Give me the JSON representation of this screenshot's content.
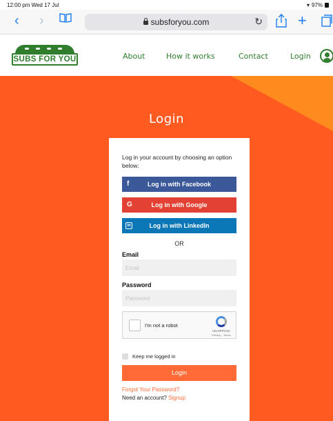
{
  "status_bar": {
    "time": "12:00 pm  Wed 17 Jul",
    "battery": "97%"
  },
  "browser": {
    "url": "subsforyou.com"
  },
  "site_nav": {
    "logo_text": "SUBS FOR YOU",
    "links": {
      "about": "About",
      "how_it_works": "How it works",
      "contact": "Contact",
      "login": "Login"
    }
  },
  "page": {
    "title": "Login"
  },
  "login_card": {
    "intro": "Log in your account by choosing an option below:",
    "facebook_label": "Log in with Facebook",
    "google_label": "Log in with Google",
    "linkedin_label": "Log in with LinkedIn",
    "facebook_icon": "f",
    "google_icon": "G",
    "linkedin_icon": "in",
    "or_text": "OR",
    "email_label": "Email",
    "email_placeholder": "Email",
    "password_label": "Password",
    "password_placeholder": "Password",
    "captcha": {
      "label": "I'm not a robot",
      "brand": "reCAPTCHA",
      "terms": "Privacy - Terms"
    },
    "keep_logged_in": "Keep me logged in",
    "login_button": "Login",
    "forgot_password": "Forgot Your Password?",
    "need_account": "Need an account?",
    "signup": "Signup"
  },
  "colors": {
    "brand_green": "#2f7d2d",
    "hero_orange": "#ff5a1f",
    "accent_orange": "#ff6a36",
    "facebook": "#3b5998",
    "google": "#e34133",
    "linkedin": "#0b77b7",
    "safari_blue": "#1a7df0"
  }
}
